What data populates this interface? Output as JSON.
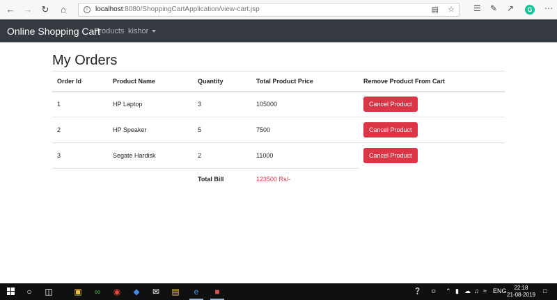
{
  "browser": {
    "url_host": "localhost",
    "url_path": ":8080/ShoppingCartApplication/view-cart.jsp"
  },
  "navbar": {
    "brand": "Online Shopping Cart",
    "products_link": "Products",
    "user_menu": "kishor"
  },
  "page": {
    "title": "My Orders"
  },
  "table": {
    "headers": [
      "Order Id",
      "Product Name",
      "Quantity",
      "Total Product Price",
      "Remove Product From Cart"
    ],
    "rows": [
      {
        "id": "1",
        "name": "HP Laptop",
        "qty": "3",
        "price": "105000",
        "action": "Cancel Product"
      },
      {
        "id": "2",
        "name": "HP Speaker",
        "qty": "5",
        "price": "7500",
        "action": "Cancel Product"
      },
      {
        "id": "3",
        "name": "Segate Hardisk",
        "qty": "2",
        "price": "11000",
        "action": "Cancel Product"
      }
    ],
    "total_label": "Total Bill",
    "total_value": "123500 Rs/-"
  },
  "taskbar": {
    "language": "ENG",
    "time": "22:18",
    "date": "21-08-2019"
  },
  "colors": {
    "navbar_bg": "#343a40",
    "danger": "#dc3545"
  }
}
